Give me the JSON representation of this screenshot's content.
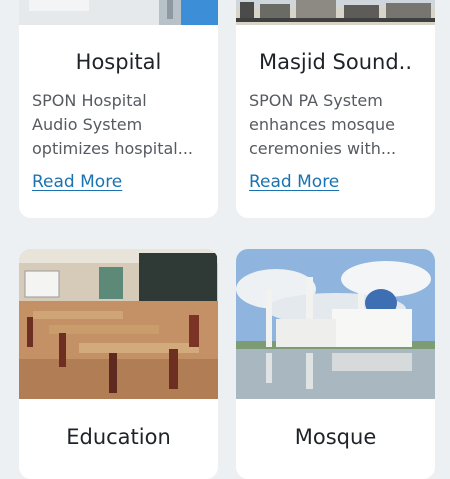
{
  "cards": [
    {
      "title": "Hospital",
      "desc_lines": [
        "SPON Hospital",
        "Audio System",
        "optimizes hospital..."
      ],
      "link": "Read More"
    },
    {
      "title": "Masjid Sound..",
      "desc_lines": [
        "SPON PA System",
        "enhances mosque",
        "ceremonies with..."
      ],
      "link": "Read More"
    },
    {
      "title": "Education",
      "desc_lines": [],
      "link": ""
    },
    {
      "title": "Mosque",
      "desc_lines": [],
      "link": ""
    }
  ],
  "colors": {
    "page_bg": "#edf0f3",
    "card_bg": "#ffffff",
    "title": "#1f2328",
    "desc": "#555b61",
    "link": "#1a73b0"
  }
}
